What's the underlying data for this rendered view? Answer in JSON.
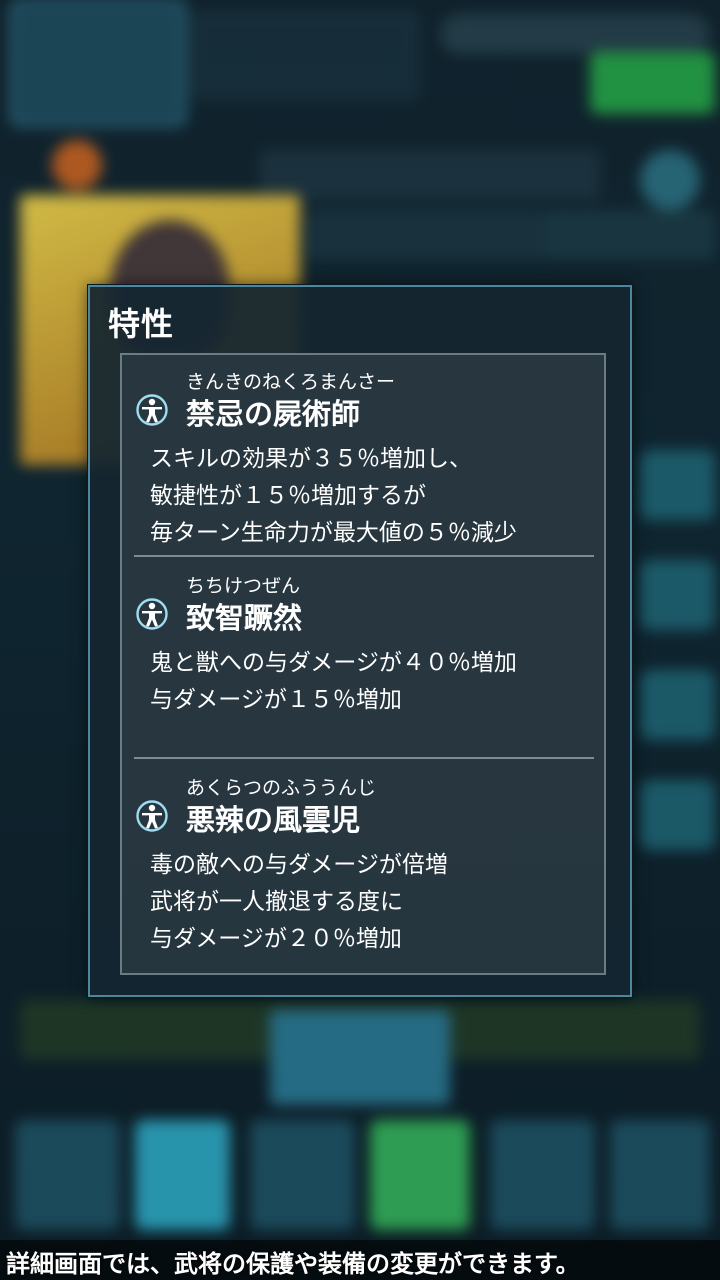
{
  "modal": {
    "title": "特性",
    "traits": [
      {
        "reading": "きんきのねくろまんさー",
        "name": "禁忌の屍術師",
        "icon": "vitruvian-figure-icon",
        "description": [
          "スキルの効果が３５％増加し、",
          "敏捷性が１５％増加するが",
          "毎ターン生命力が最大値の５％減少"
        ]
      },
      {
        "reading": "ちちけつぜん",
        "name": "致智蹶然",
        "icon": "vitruvian-figure-icon",
        "description": [
          "鬼と獣への与ダメージが４０％増加",
          "与ダメージが１５％増加"
        ]
      },
      {
        "reading": "あくらつのふううんじ",
        "name": "悪辣の風雲児",
        "icon": "vitruvian-figure-icon",
        "description": [
          "毒の敵への与ダメージが倍増",
          "武将が一人撤退する度に",
          "与ダメージが２０％増加"
        ]
      }
    ]
  },
  "caption": "詳細画面では、武将の保護や装備の変更ができます。",
  "colors": {
    "modal_border": "#4b88a0",
    "panel_border": "#6a7d86",
    "icon_color": "#9fdcf0",
    "text": "#ffffff"
  }
}
